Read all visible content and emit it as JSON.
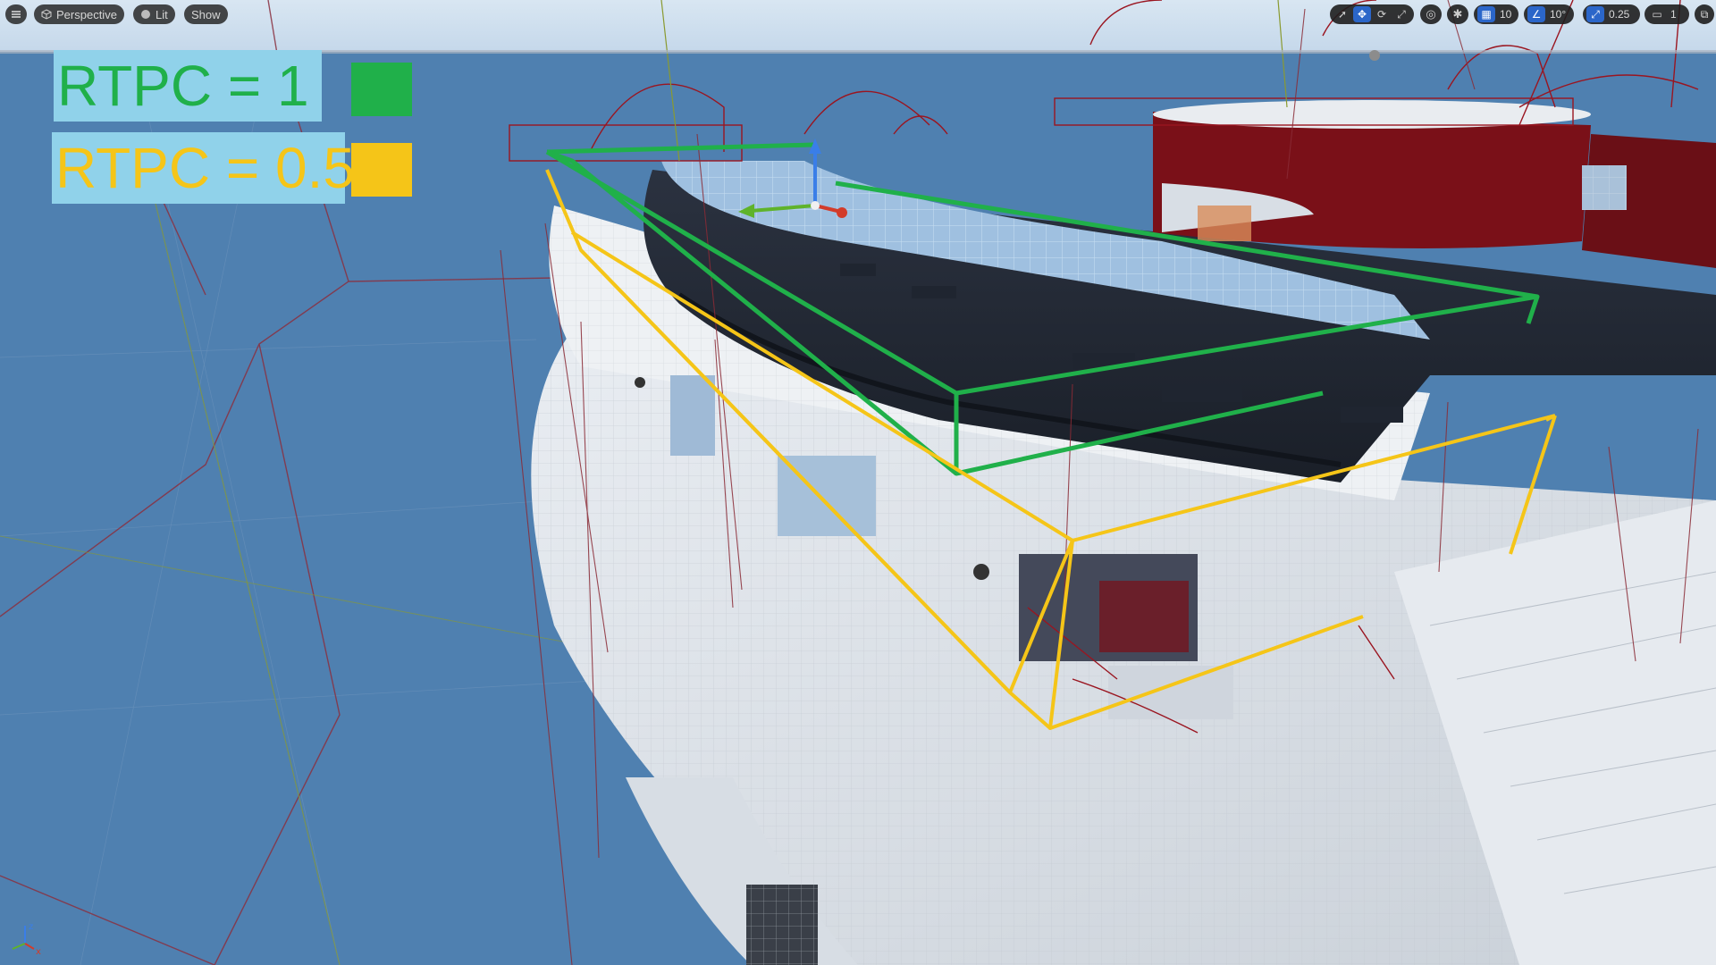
{
  "toolbar": {
    "menu_icon": "hamburger-icon",
    "perspective_label": "Perspective",
    "lit_label": "Lit",
    "show_label": "Show",
    "grid_snap_value": "10",
    "rotation_snap_value": "10°",
    "scale_snap_value": "0.25",
    "camera_speed_value": "1",
    "accent_color": "#2b66c9"
  },
  "legend": {
    "green": {
      "label": "RTPC = 1",
      "color": "#20b04a"
    },
    "yellow": {
      "label": "RTPC = 0.5",
      "color": "#f5c518"
    }
  },
  "axis_gizmo": {
    "z": "z",
    "x": "x"
  }
}
